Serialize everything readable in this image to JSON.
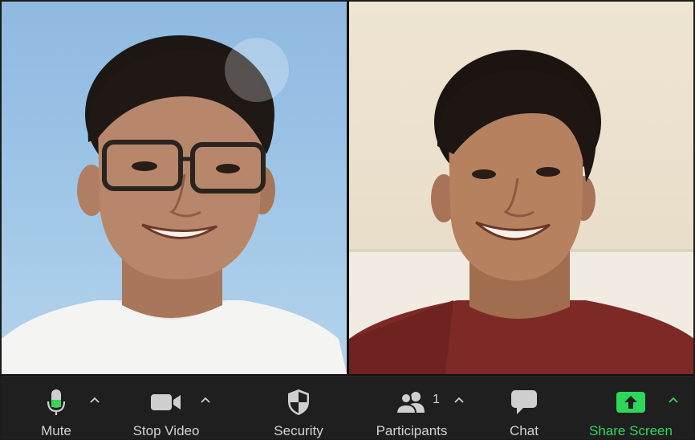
{
  "toolbar": {
    "mute": {
      "label": "Mute",
      "icon": "microphone-icon"
    },
    "video": {
      "label": "Stop Video",
      "icon": "video-camera-icon"
    },
    "security": {
      "label": "Security",
      "icon": "shield-icon"
    },
    "participants": {
      "label": "Participants",
      "count": "1",
      "icon": "participants-icon"
    },
    "chat": {
      "label": "Chat",
      "icon": "chat-bubble-icon"
    },
    "share": {
      "label": "Share Screen",
      "icon": "share-screen-icon"
    }
  },
  "colors": {
    "toolbar_bg": "#1f1f1f",
    "label": "#d2d2d2",
    "share_green": "#2ed65a",
    "mic_level_green": "#3bd35b"
  }
}
